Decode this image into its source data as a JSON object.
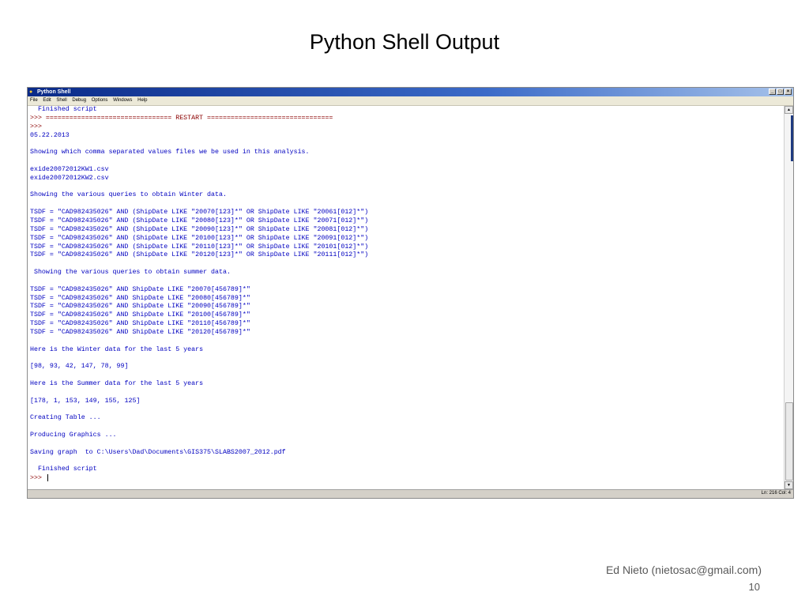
{
  "slide": {
    "title": "Python Shell Output",
    "author": "Ed Nieto (nietosac@gmail.com)",
    "page_number": "10"
  },
  "window": {
    "title": "Python Shell",
    "menu": [
      "File",
      "Edit",
      "Shell",
      "Debug",
      "Options",
      "Windows",
      "Help"
    ],
    "status": "Ln: 216 Col: 4"
  },
  "shell": {
    "lines": [
      {
        "text": "  Finished script"
      },
      {
        "text": ">>> ================================ RESTART ================================"
      },
      {
        "text": ">>>"
      },
      {
        "text": "05.22.2013"
      },
      {
        "text": ""
      },
      {
        "text": "Showing which comma separated values files we be used in this analysis."
      },
      {
        "text": ""
      },
      {
        "text": "exide20072012KW1.csv"
      },
      {
        "text": "exide20072012KW2.csv"
      },
      {
        "text": ""
      },
      {
        "text": "Showing the various queries to obtain Winter data."
      },
      {
        "text": ""
      },
      {
        "text": "TSDF = \"CAD982435026\" AND (ShipDate LIKE \"20070[123]*\" OR ShipDate LIKE \"20061[012]*\")"
      },
      {
        "text": "TSDF = \"CAD982435026\" AND (ShipDate LIKE \"20080[123]*\" OR ShipDate LIKE \"20071[012]*\")"
      },
      {
        "text": "TSDF = \"CAD982435026\" AND (ShipDate LIKE \"20090[123]*\" OR ShipDate LIKE \"20081[012]*\")"
      },
      {
        "text": "TSDF = \"CAD982435026\" AND (ShipDate LIKE \"20100[123]*\" OR ShipDate LIKE \"20091[012]*\")"
      },
      {
        "text": "TSDF = \"CAD982435026\" AND (ShipDate LIKE \"20110[123]*\" OR ShipDate LIKE \"20101[012]*\")"
      },
      {
        "text": "TSDF = \"CAD982435026\" AND (ShipDate LIKE \"20120[123]*\" OR ShipDate LIKE \"20111[012]*\")"
      },
      {
        "text": ""
      },
      {
        "text": " Showing the various queries to obtain summer data."
      },
      {
        "text": ""
      },
      {
        "text": "TSDF = \"CAD982435026\" AND ShipDate LIKE \"20070[456789]*\""
      },
      {
        "text": "TSDF = \"CAD982435026\" AND ShipDate LIKE \"20080[456789]*\""
      },
      {
        "text": "TSDF = \"CAD982435026\" AND ShipDate LIKE \"20090[456789]*\""
      },
      {
        "text": "TSDF = \"CAD982435026\" AND ShipDate LIKE \"20100[456789]*\""
      },
      {
        "text": "TSDF = \"CAD982435026\" AND ShipDate LIKE \"20110[456789]*\""
      },
      {
        "text": "TSDF = \"CAD982435026\" AND ShipDate LIKE \"20120[456789]*\""
      },
      {
        "text": ""
      },
      {
        "text": "Here is the Winter data for the last 5 years"
      },
      {
        "text": ""
      },
      {
        "text": "[98, 93, 42, 147, 78, 99]"
      },
      {
        "text": ""
      },
      {
        "text": "Here is the Summer data for the last 5 years"
      },
      {
        "text": ""
      },
      {
        "text": "[178, 1, 153, 149, 155, 125]"
      },
      {
        "text": ""
      },
      {
        "text": "Creating Table ..."
      },
      {
        "text": ""
      },
      {
        "text": "Producing Graphics ..."
      },
      {
        "text": ""
      },
      {
        "text": "Saving graph  to C:\\Users\\Dad\\Documents\\GIS375\\SLABS2007_2012.pdf"
      },
      {
        "text": ""
      },
      {
        "text": "  Finished script"
      },
      {
        "text": ">>> ",
        "prompt": true
      }
    ]
  },
  "colors": {
    "output_text": "#0000c0",
    "titlebar": "#0a2a88"
  }
}
